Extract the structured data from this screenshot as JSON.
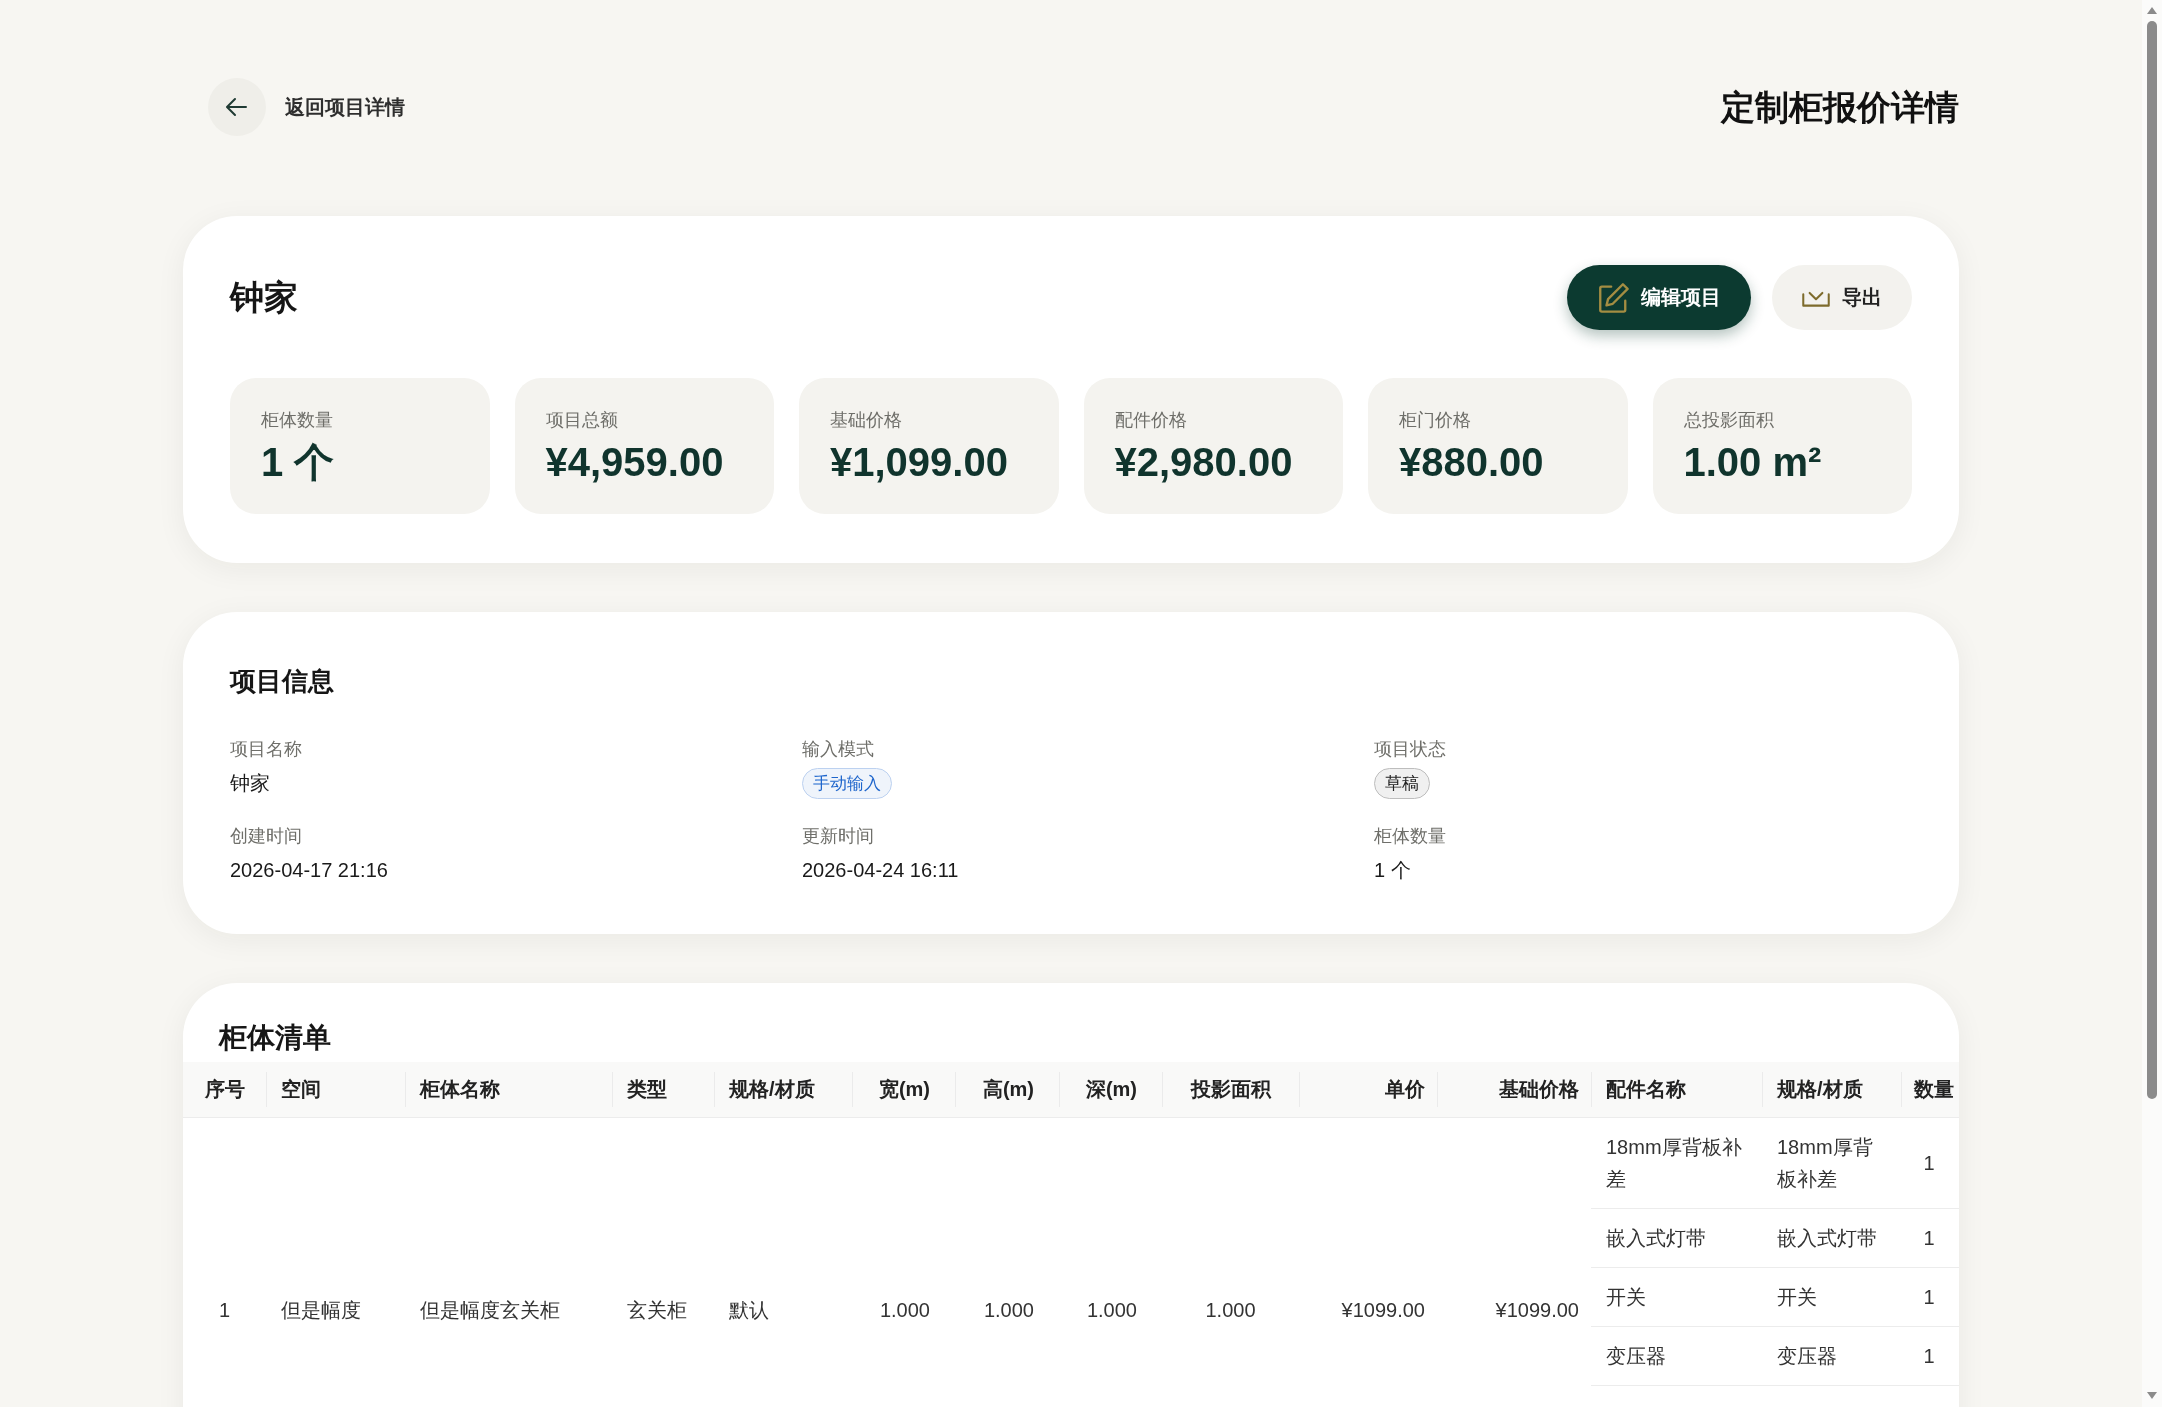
{
  "header": {
    "back_link": "返回项目详情",
    "title": "定制柜报价详情"
  },
  "project_card": {
    "name": "钟家",
    "actions": [
      {
        "kind": "edit",
        "label": "编辑项目"
      },
      {
        "kind": "export",
        "label": "导出"
      }
    ],
    "stats": [
      {
        "label": "柜体数量",
        "value": "1 个"
      },
      {
        "label": "项目总额",
        "value": "¥4,959.00"
      },
      {
        "label": "基础价格",
        "value": "¥1,099.00"
      },
      {
        "label": "配件价格",
        "value": "¥2,980.00"
      },
      {
        "label": "柜门价格",
        "value": "¥880.00"
      },
      {
        "label": "总投影面积",
        "value": "1.00 m²"
      }
    ]
  },
  "project_info": {
    "title": "项目信息",
    "fields": [
      {
        "label": "项目名称",
        "value": "钟家",
        "kind": "text"
      },
      {
        "label": "输入模式",
        "value": "手动输入",
        "kind": "tag",
        "color": "#1f66cc"
      },
      {
        "label": "项目状态",
        "value": "草稿",
        "kind": "tag",
        "color": "#222222"
      },
      {
        "label": "创建时间",
        "value": "2026-04-17 21:16",
        "kind": "text"
      },
      {
        "label": "更新时间",
        "value": "2026-04-24 16:11",
        "kind": "text"
      },
      {
        "label": "柜体数量",
        "value": "1 个",
        "kind": "text"
      }
    ]
  },
  "cabinet_list": {
    "title": "柜体清单",
    "columns": [
      "序号",
      "空间",
      "柜体名称",
      "类型",
      "规格/材质",
      "宽(m)",
      "高(m)",
      "深(m)",
      "投影面积",
      "单价",
      "基础价格",
      "配件名称",
      "规格/材质",
      "数量"
    ],
    "rows": [
      {
        "cells": [
          "1",
          "但是幅度",
          "但是幅度玄关柜",
          "玄关柜",
          "默认",
          "1.000",
          "1.000",
          "1.000",
          "1.000",
          "¥1099.00",
          "¥1099.00"
        ],
        "accessories": [
          {
            "name": "18mm厚背板补差",
            "spec": "18mm厚背板补差",
            "quantity": "1"
          },
          {
            "name": "嵌入式灯带",
            "spec": "嵌入式灯带",
            "quantity": "1"
          },
          {
            "name": "开关",
            "spec": "开关",
            "quantity": "1"
          },
          {
            "name": "变压器",
            "spec": "变压器",
            "quantity": "1"
          }
        ]
      }
    ]
  }
}
